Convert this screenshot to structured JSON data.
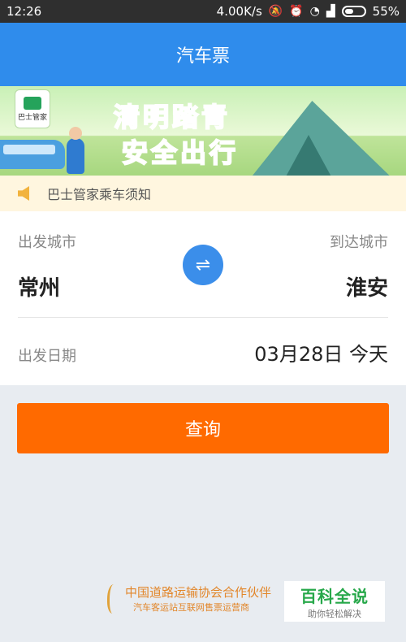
{
  "status_bar": {
    "time": "12:26",
    "network_speed": "4.00K/s",
    "battery_percent": "55%",
    "battery_level": 0.55,
    "icons": [
      "mute-icon",
      "alarm-icon",
      "wifi-icon",
      "signal-icon",
      "battery-icon"
    ]
  },
  "header": {
    "title": "汽车票"
  },
  "banner": {
    "slogan_line1": "清明踏青",
    "slogan_line2": "安全出行",
    "logo_text": "巴士管家"
  },
  "notice": {
    "text": "巴士管家乘车须知"
  },
  "form": {
    "departure_label": "出发城市",
    "departure_city": "常州",
    "arrival_label": "到达城市",
    "arrival_city": "淮安",
    "date_label": "出发日期",
    "date_value": "03月28日 今天",
    "swap_icon": "⇌"
  },
  "search_button": {
    "label": "查询"
  },
  "colors": {
    "primary": "#2f8cec",
    "accent": "#ff6a00"
  },
  "footer": {
    "partner_line1": "中国道路运输协会合作伙伴",
    "partner_line2": "汽车客运站互联网售票运营商"
  },
  "watermark": {
    "title": "百科全说",
    "subtitle": "助你轻松解决"
  }
}
